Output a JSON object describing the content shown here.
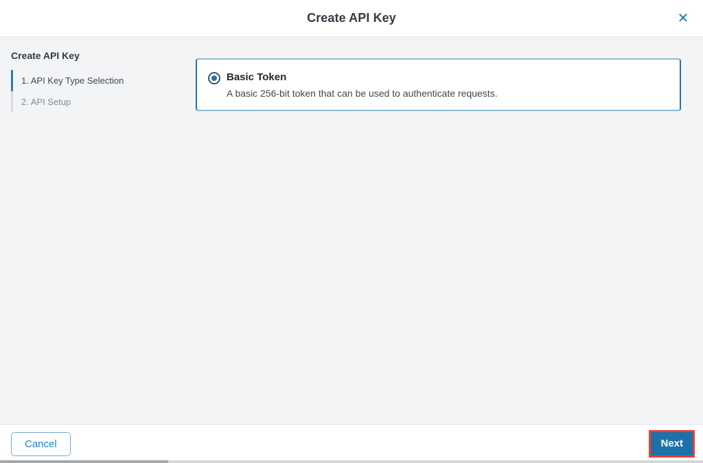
{
  "modal": {
    "title": "Create API Key",
    "close_icon": "✕"
  },
  "sidebar": {
    "heading": "Create API Key",
    "steps": [
      {
        "label": "1. API Key Type Selection",
        "active": true
      },
      {
        "label": "2. API Setup",
        "active": false
      }
    ]
  },
  "content": {
    "option": {
      "label": "Basic Token",
      "description": "A basic 256-bit token that can be used to authenticate requests.",
      "selected": true
    }
  },
  "footer": {
    "cancel_label": "Cancel",
    "next_label": "Next"
  },
  "colors": {
    "accent_blue": "#1c72a8",
    "link_blue": "#1f83c6",
    "active_step_marker": "#2a7cb4",
    "card_border": "#8cb9d6",
    "highlight_red": "#e8403a",
    "body_background": "#f3f4f6"
  }
}
